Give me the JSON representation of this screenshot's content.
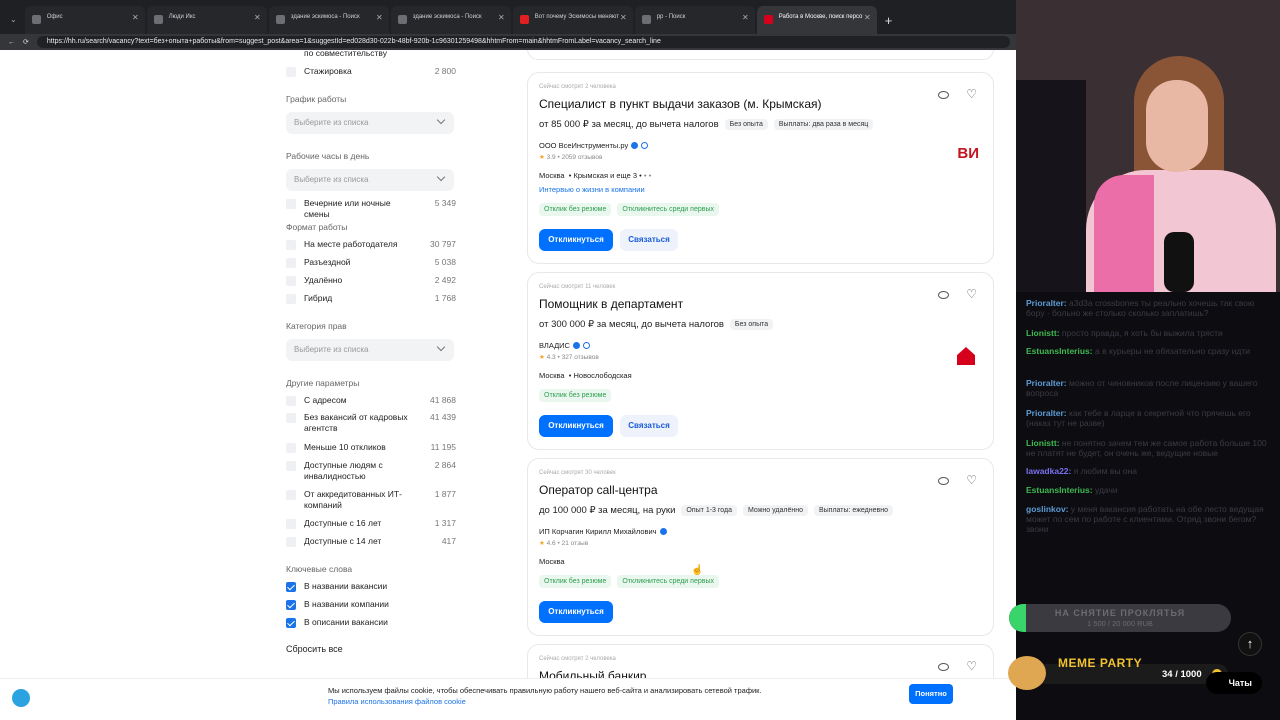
{
  "browser": {
    "tabs": [
      {
        "label": "Офис",
        "active": false
      },
      {
        "label": "Люди Икс",
        "active": false
      },
      {
        "label": "здание эскимоса - Поиск",
        "active": false
      },
      {
        "label": "здание эскимоса - Поиск",
        "active": false
      },
      {
        "label": "Вот почему Эскимосы меняют",
        "active": false
      },
      {
        "label": "рр - Поиск",
        "active": false
      },
      {
        "label": "Работа в Москве, поиск персо",
        "active": true
      }
    ],
    "url": "https://hh.ru/search/vacancy?text=без+опыта+работы&from=suggest_post&area=1&suggestId=ed028d30-022b-48bf-920b-1c96301259498&hhtmFrom=main&hhtmFromLabel=vacancy_search_line"
  },
  "filters": {
    "top_item_cut": "по совместительству",
    "internship": {
      "label": "Стажировка",
      "count": "2 800"
    },
    "schedule": {
      "title": "График работы",
      "placeholder": "Выберите из списка"
    },
    "hours": {
      "title": "Рабочие часы в день",
      "placeholder": "Выберите из списка"
    },
    "evening": {
      "label": "Вечерние или ночные смены",
      "count": "5 349"
    },
    "format": {
      "title": "Формат работы",
      "items": [
        {
          "label": "На месте работодателя",
          "count": "30 797"
        },
        {
          "label": "Разъездной",
          "count": "5 038"
        },
        {
          "label": "Удалённо",
          "count": "2 492"
        },
        {
          "label": "Гибрид",
          "count": "1 768"
        }
      ]
    },
    "license": {
      "title": "Категория прав",
      "placeholder": "Выберите из списка"
    },
    "other": {
      "title": "Другие параметры",
      "items": [
        {
          "label": "С адресом",
          "count": "41 868"
        },
        {
          "label": "Без вакансий от кадровых агентств",
          "count": "41 439"
        },
        {
          "label": "Меньше 10 откликов",
          "count": "11 195"
        },
        {
          "label": "Доступные людям с инвалидностью",
          "count": "2 864"
        },
        {
          "label": "От аккредитованных ИТ-компаний",
          "count": "1 877"
        },
        {
          "label": "Доступные с 16 лет",
          "count": "1 317"
        },
        {
          "label": "Доступные с 14 лет",
          "count": "417"
        }
      ]
    },
    "keywords": {
      "title": "Ключевые слова",
      "items": [
        {
          "label": "В названии вакансии"
        },
        {
          "label": "В названии компании"
        },
        {
          "label": "В описании вакансии"
        }
      ]
    },
    "reset": "Сбросить все"
  },
  "vacancies": [
    {
      "watching": "Сейчас смотрят 2 человека",
      "title": "Специалист в пункт выдачи заказов (м. Крымская)",
      "salary": "от 85 000 ₽ за месяц, до вычета налогов",
      "pills": [
        "Без опыта",
        "Выплаты: два раза в месяц"
      ],
      "company": "ООО ВсеИнструменты.ру",
      "rating": "3.9",
      "reviews": "2059 отзывов",
      "location": "Москва",
      "metro": "Крымская и еще 3",
      "link": "Интервью о жизни в компании",
      "tags": [
        "Отклик без резюме",
        "Откликнитесь среди первых"
      ],
      "apply": "Откликнуться",
      "contact": "Связаться",
      "logo": "ВИ"
    },
    {
      "watching": "Сейчас смотрят 11 человек",
      "title": "Помощник в департамент",
      "salary": "от 300 000 ₽ за месяц, до вычета налогов",
      "pills": [
        "Без опыта"
      ],
      "company": "ВЛАДИС",
      "rating": "4.3",
      "reviews": "327 отзывов",
      "location": "Москва",
      "metro": "Новослободская",
      "tags": [
        "Отклик без резюме"
      ],
      "apply": "Откликнуться",
      "contact": "Связаться"
    },
    {
      "watching": "Сейчас смотрят 30 человек",
      "title": "Оператор call-центра",
      "salary": "до 100 000 ₽ за месяц, на руки",
      "pills": [
        "Опыт 1-3 года",
        "Можно удалённо",
        "Выплаты: ежедневно"
      ],
      "company": "ИП Корчагин Кирилл Михайлович",
      "rating": "4.6",
      "reviews": "21 отзыв",
      "location": "Москва",
      "tags": [
        "Отклик без резюме",
        "Откликнитесь среди первых"
      ],
      "apply": "Откликнуться"
    },
    {
      "watching": "Сейчас смотрят 2 человека",
      "title": "Мобильный банкир"
    }
  ],
  "cookie": {
    "text": "Мы используем файлы cookie, чтобы обеспечивать правильную работу нашего веб-сайта и анализировать сетевой трафик.",
    "link": "Правила использования файлов cookie",
    "ok": "Понятно"
  },
  "chat": [
    {
      "user": "Prioralter:",
      "color": "#5b9bd5",
      "text": "a3d3a crossbones ты реально хочешь так свою бору · больно же столько сколько заплатишь?"
    },
    {
      "user": "Lionistt:",
      "color": "#3fb950",
      "text": "просто правда, я хоть бы выжила трясти"
    },
    {
      "user": "EstuansInterius:",
      "color": "#3fb950",
      "text": "а в курьеры не обязательно сразу идти"
    },
    {
      "user": "Prioralter:",
      "color": "#5b9bd5",
      "text": "можно от чиновников после лицензию у вашего вопроса"
    },
    {
      "user": "Prioralter:",
      "color": "#5b9bd5",
      "text": "как тебе в ларце в секретной что прячешь его (наказ тут не разве)"
    },
    {
      "user": "Lionistt:",
      "color": "#3fb950",
      "text": "не понятно зачем тем же самое работа больше 100 не платят не будет, он очень же, ведущие новые"
    },
    {
      "user": "Iawadka22:",
      "color": "#7a6ff0",
      "text": "я любим вы она"
    },
    {
      "user": "EstuansInterius:",
      "color": "#3fb950",
      "text": "удачи"
    },
    {
      "user": "goslinkov:",
      "color": "#5b9bd5",
      "text": "у меня вакансия работать на обе лесто ведущая может по сем по работе с клиентами. Отряд звони бегом? звони"
    }
  ],
  "overlay": {
    "goal_title": "НА СНЯТИЕ ПРОКЛЯТЬЯ",
    "goal_progress": "1 500 / 20 000 RUB",
    "goal_fraction": 0.075,
    "meme_title": "MEME PARTY",
    "meme_value": "34 / 1000",
    "chats_btn": "Чаты"
  }
}
